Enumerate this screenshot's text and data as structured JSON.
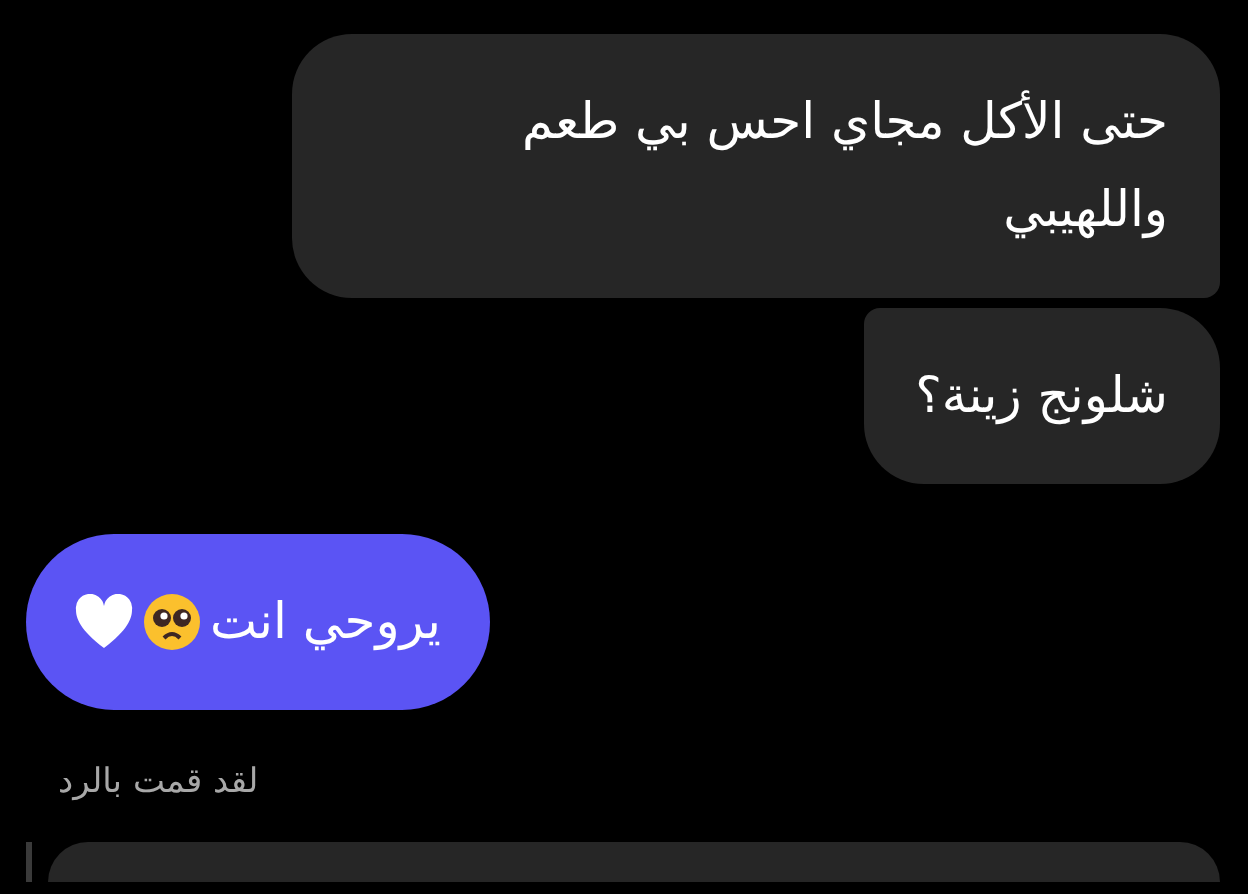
{
  "messages": [
    {
      "kind": "incoming",
      "text": "حتى الأكل مجاي احس بي طعم واللهيبي"
    },
    {
      "kind": "incoming",
      "text": "شلونج زينة؟"
    },
    {
      "kind": "outgoing",
      "text": "يروحي انت"
    }
  ],
  "reply": {
    "label": "لقد قمت بالرد"
  }
}
